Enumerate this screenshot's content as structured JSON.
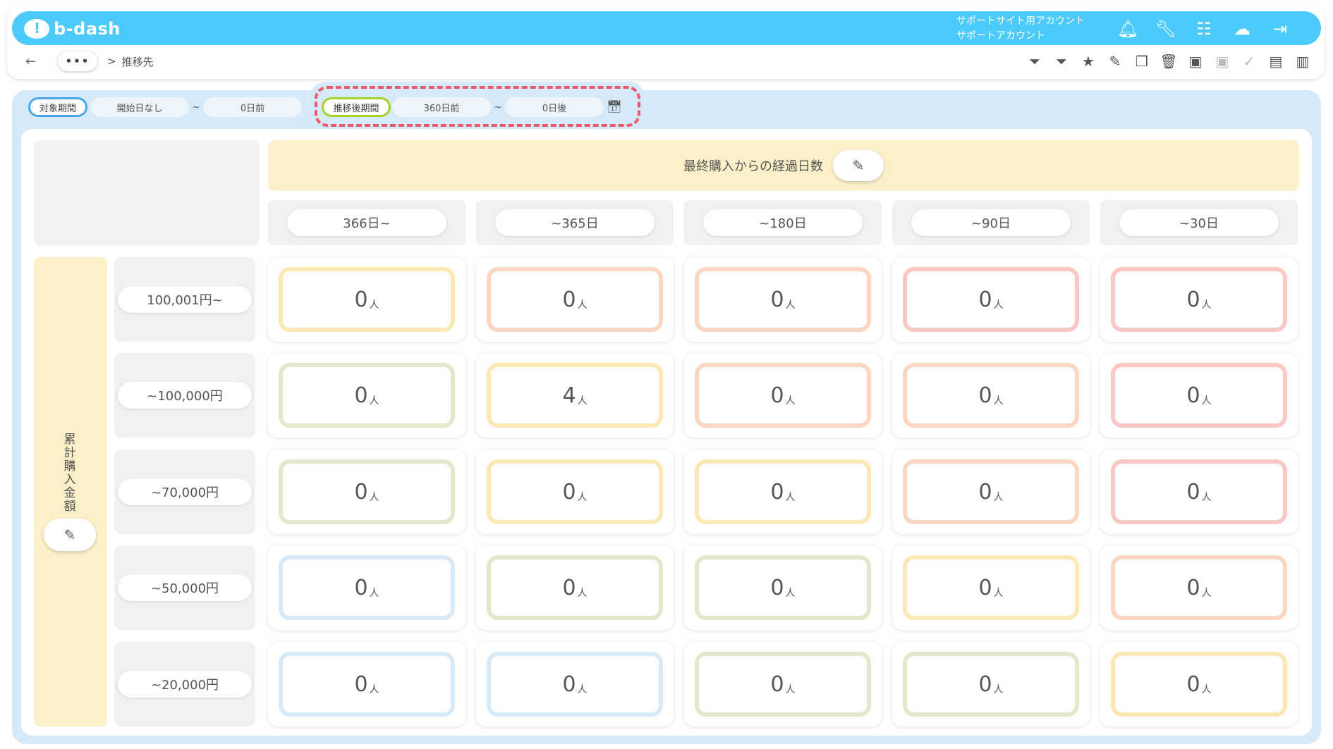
{
  "app": {
    "logo_text": "b-dash",
    "account_line1": "サポートサイト用アカウント",
    "account_line2": "サポートアカウント"
  },
  "header_icons": [
    "bell-icon",
    "wrench-icon",
    "apps-grid-icon",
    "chat-bot-icon",
    "logout-icon"
  ],
  "breadcrumb": {
    "back": "←",
    "ellipsis": "•••",
    "separator": ">",
    "current": "推移先"
  },
  "toolbar_icons": [
    {
      "name": "filter-user-icon",
      "glyph": "⏷",
      "dim": false
    },
    {
      "name": "filter-icon",
      "glyph": "⏷",
      "dim": false
    },
    {
      "name": "star-icon",
      "glyph": "★",
      "dim": false
    },
    {
      "name": "edit-icon",
      "glyph": "✎",
      "dim": false
    },
    {
      "name": "copy-icon",
      "glyph": "❐",
      "dim": false
    },
    {
      "name": "trash-icon",
      "glyph": "🗑",
      "dim": false
    },
    {
      "name": "archive-icon",
      "glyph": "▣",
      "dim": false
    },
    {
      "name": "unarchive-icon",
      "glyph": "▣",
      "dim": true
    },
    {
      "name": "user-check-icon",
      "glyph": "✓",
      "dim": true
    },
    {
      "name": "document-icon",
      "glyph": "▤",
      "dim": false
    },
    {
      "name": "clipboard-icon",
      "glyph": "▥",
      "dim": false
    }
  ],
  "period": {
    "target": {
      "label": "対象期間",
      "start": "開始日なし",
      "tilde": "~",
      "end": "0日前"
    },
    "after": {
      "label": "推移後期間",
      "start": "360日前",
      "tilde": "~",
      "end": "0日後"
    }
  },
  "matrix": {
    "col_title": "最終購入からの経過日数",
    "row_title": "累計購入金額",
    "columns": [
      "366日~",
      "~365日",
      "~180日",
      "~90日",
      "~30日"
    ],
    "rows": [
      {
        "label": "100,001円~",
        "cells": [
          "0",
          "0",
          "0",
          "0",
          "0"
        ]
      },
      {
        "label": "~100,000円",
        "cells": [
          "0",
          "4",
          "0",
          "0",
          "0"
        ]
      },
      {
        "label": "~70,000円",
        "cells": [
          "0",
          "0",
          "0",
          "0",
          "0"
        ]
      },
      {
        "label": "~50,000円",
        "cells": [
          "0",
          "0",
          "0",
          "0",
          "0"
        ]
      },
      {
        "label": "~20,000円",
        "cells": [
          "0",
          "0",
          "0",
          "0",
          "0"
        ]
      }
    ],
    "unit": "人",
    "colors": [
      [
        "#fbe8b4",
        "#fbd6c0",
        "#fbd6c0",
        "#f9c8c4",
        "#f9c8c4"
      ],
      [
        "#e3e8cc",
        "#fbe8b4",
        "#fbd6c0",
        "#fbd6c0",
        "#f9c8c4"
      ],
      [
        "#e3e8cc",
        "#fbe8b4",
        "#fbe8b4",
        "#fbd6c0",
        "#f9c8c4"
      ],
      [
        "#d8e9f7",
        "#e3e8cc",
        "#e3e8cc",
        "#fbe8b4",
        "#fbd6c0"
      ],
      [
        "#d8e9f7",
        "#d8e9f7",
        "#e3e8cc",
        "#e3e8cc",
        "#fbe8b4"
      ]
    ]
  }
}
